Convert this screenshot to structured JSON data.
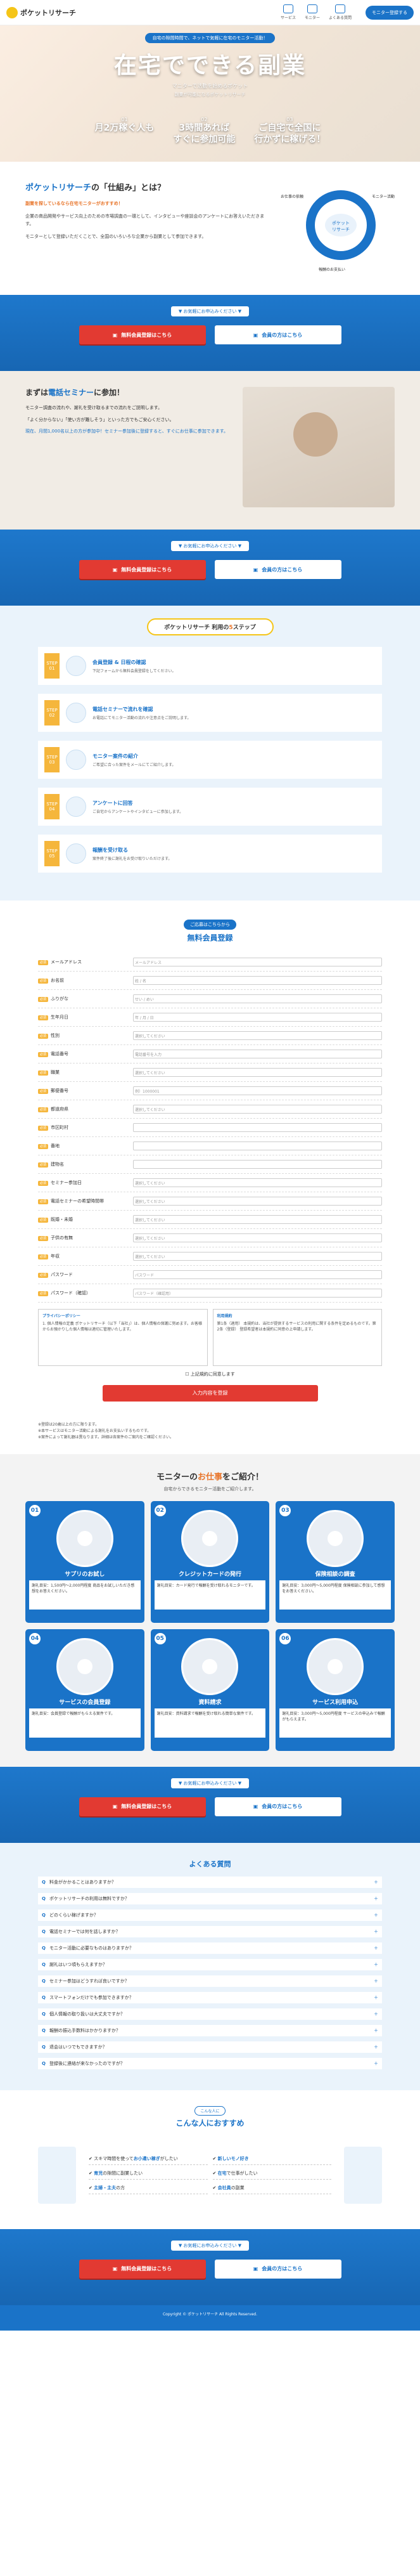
{
  "header": {
    "brand": "ポケットリサーチ",
    "nav": [
      "サービス",
      "モニター",
      "よくある質問"
    ],
    "cta": "モニター登録する"
  },
  "hero": {
    "tag": "自宅の隙間時間で、ネットで気軽に在宅のモニター活動！",
    "title": "在宅でできる副業",
    "sub": "マニターで活動を始めるポケット",
    "sub2": "副業が可能になるポケットリサーチ",
    "feats": [
      {
        "n": "01",
        "t": "月2万稼ぐ人も"
      },
      {
        "n": "02",
        "t": "3時間あれば\nすぐに参加可能"
      },
      {
        "n": "03",
        "t": "ご自宅で全国に\n行かずに稼げる！"
      }
    ]
  },
  "about": {
    "title_pre": "ポケットリサーチ",
    "title_post": "の「仕組み」とは？",
    "p1": "副業を探しているなら在宅モニターがおすすめ！",
    "p2": "企業の商品開発やサービス向上のための市場調査の一環として、インタビューや座談会のアンケートにお答えいただきます。",
    "p3": "モニターとして登録いただくことで、全国のいろいろな企業から副業として参加できます。",
    "cycle": {
      "center": "ポケット\nリサーチ",
      "a": "お仕事の依頼",
      "b": "モニター活動",
      "c": "報酬のお支払い"
    }
  },
  "cta": {
    "note": "▼ お気軽にお申込みください ▼",
    "register": "無料会員登録はこちら",
    "guide": "会員の方はこちら"
  },
  "seminar": {
    "title_pre": "まずは",
    "title_hl": "電話セミナー",
    "title_post": "に参加！",
    "p1": "モニター調査の流れや、謝礼を受け取るまでの流れをご説明します。",
    "p2": "「よく分からない」「使い方が難しそう」といった方でもご安心ください。",
    "p3": "現在、月間1,000名以上の方が参加中！セミナー参加後に登録すると、すぐにお仕事に参加できます。"
  },
  "steps": {
    "title_pre": "ポケットリサーチ 利用の",
    "title_hl": "5",
    "title_post": "ステップ",
    "items": [
      {
        "n": "STEP 01",
        "t": "会員登録 & 日程の確認",
        "d": "下記フォームから無料会員登録をしてください。"
      },
      {
        "n": "STEP 02",
        "t": "電話セミナーで流れを確認",
        "d": "お電話にてモニター活動の流れや注意点をご説明します。"
      },
      {
        "n": "STEP 03",
        "t": "モニター案件の紹介",
        "d": "ご希望に合った案件をメールにてご紹介します。"
      },
      {
        "n": "STEP 04",
        "t": "アンケートに回答",
        "d": "ご自宅からアンケートやインタビューに参加します。"
      },
      {
        "n": "STEP 05",
        "t": "報酬を受け取る",
        "d": "案件終了後に謝礼をお受け取りいただけます。"
      }
    ]
  },
  "form": {
    "badge": "ご応募はこちらから",
    "title": "無料会員登録",
    "req": "必須",
    "fields": [
      {
        "l": "メールアドレス",
        "p": "メールアドレス"
      },
      {
        "l": "お名前",
        "p": "姓 / 名"
      },
      {
        "l": "ふりがな",
        "p": "せい / めい"
      },
      {
        "l": "生年月日",
        "p": "年 / 月 / 日"
      },
      {
        "l": "性別",
        "p": "選択してください"
      },
      {
        "l": "電話番号",
        "p": "電話番号を入力"
      },
      {
        "l": "職業",
        "p": "選択してください"
      },
      {
        "l": "郵便番号",
        "p": "例）1000001"
      },
      {
        "l": "都道府県",
        "p": "選択してください"
      },
      {
        "l": "市区町村",
        "p": ""
      },
      {
        "l": "番地",
        "p": ""
      },
      {
        "l": "建物名",
        "p": ""
      },
      {
        "l": "セミナー参加日",
        "p": "選択してください"
      },
      {
        "l": "電話セミナーの希望時間帯",
        "p": "選択してください"
      },
      {
        "l": "既婚・未婚",
        "p": "選択してください"
      },
      {
        "l": "子供の有無",
        "p": "選択してください"
      },
      {
        "l": "年収",
        "p": "選択してください"
      },
      {
        "l": "パスワード",
        "p": "パスワード"
      },
      {
        "l": "パスワード（確認）",
        "p": "パスワード（確認用）"
      }
    ],
    "privacy_title": "プライバシーポリシー",
    "privacy_text": "1. 個人情報の定義 ポケットリサーチ（以下「当社」）は、個人情報の保護に努めます。お客様からお預かりした個人情報は適切に管理いたします。",
    "terms_title": "利用規約",
    "terms_text": "第1条（適用） 本規約は、当社が提供するサービスの利用に関する条件を定めるものです。第2条（登録） 登録希望者は本規約に同意の上申請します。",
    "agree": "上記規約に同意します",
    "submit": "入力内容を登録"
  },
  "notes": [
    "※登録は20歳以上の方に限ります。",
    "※本サービスはモニター活動による謝礼をお支払いするものです。",
    "※案件によって謝礼額は異なります。詳細は各案件のご案内をご確認ください。"
  ],
  "work": {
    "title_pre": "モニターの",
    "title_hl": "お仕事",
    "title_post": "をご紹介！",
    "sub": "自宅からできるモニター活動をご紹介します。",
    "cards": [
      {
        "n": "01",
        "t": "サプリのお試し",
        "d": "謝礼目安：1,500円〜2,000円程度 商品をお試しいただき感想をお答えください。"
      },
      {
        "n": "02",
        "t": "クレジットカードの発行",
        "d": "謝礼目安：カード発行で報酬を受け取れるモニターです。"
      },
      {
        "n": "03",
        "t": "保険相談の調査",
        "d": "謝礼目安：3,000円〜5,000円程度 保険相談に参加して感想をお答えください。"
      },
      {
        "n": "04",
        "t": "サービスの会員登録",
        "d": "謝礼目安：会員登録で報酬がもらえる案件です。"
      },
      {
        "n": "05",
        "t": "資料請求",
        "d": "謝礼目安：資料請求で報酬を受け取れる簡単な案件です。"
      },
      {
        "n": "06",
        "t": "サービス利用申込",
        "d": "謝礼目安：3,000円〜5,000円程度 サービスの申込みで報酬がもらえます。"
      }
    ]
  },
  "faq": {
    "title": "よくある質問",
    "items": [
      "料金がかかることはありますか？",
      "ポケットリサーチの利用は無料ですか？",
      "どのくらい稼げますか？",
      "電話セミナーでは何を話しますか？",
      "モニター活動に必要なものはありますか？",
      "謝礼はいつ頃もらえますか？",
      "セミナー参加はどうすれば良いですか？",
      "スマートフォンだけでも参加できますか？",
      "個人情報の取り扱いは大丈夫ですか？",
      "報酬の振込手数料はかかりますか？",
      "退会はいつでもできますか？",
      "登録後に連絡が来なかったのですが？"
    ]
  },
  "rec": {
    "badge": "こんな人に",
    "title": "こんな人におすすめ",
    "items": [
      {
        "a": "スキマ時間を使って",
        "b": "お小遣い稼ぎ",
        "c": "がしたい"
      },
      {
        "a": "",
        "b": "新しいモノ好き",
        "c": ""
      },
      {
        "a": "",
        "b": "育児",
        "c": "の隙間に副業したい"
      },
      {
        "a": "",
        "b": "在宅",
        "c": "で仕事がしたい"
      },
      {
        "a": "",
        "b": "主婦・主夫",
        "c": "の方"
      },
      {
        "a": "",
        "b": "会社員",
        "c": "の副業"
      }
    ]
  },
  "footer": "Copyright © ポケットリサーチ All Rights Reserved."
}
